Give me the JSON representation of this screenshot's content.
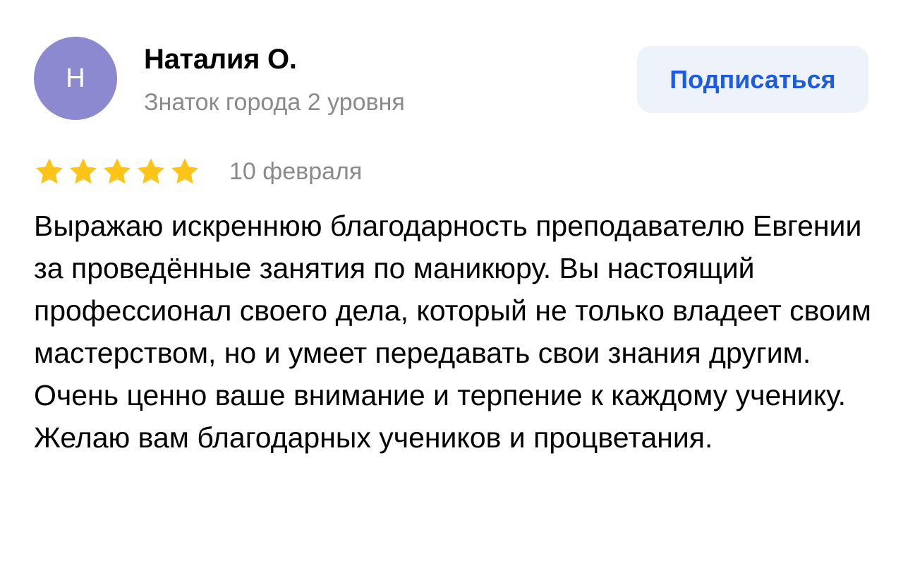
{
  "review": {
    "author": {
      "initial": "Н",
      "name": "Наталия О.",
      "level": "Знаток города 2 уровня"
    },
    "subscribe_label": "Подписаться",
    "rating": {
      "value": 5,
      "max": 5,
      "star_color": "#fcc419"
    },
    "date": "10 февраля",
    "text": "Выражаю искреннюю благодарность преподавателю Евгении за проведённые занятия по маникюру. Вы настоящий профессионал своего дела, который не только владеет своим мастерством, но и умеет передавать свои знания другим. Очень ценно ваше внимание и терпение к каждому ученику. Желаю вам благодарных учеников и процветания."
  },
  "colors": {
    "avatar_bg": "#8d89d0",
    "subscribe_bg": "#eef3fb",
    "subscribe_text": "#1f5bde",
    "secondary_text": "#8a8a8a"
  }
}
